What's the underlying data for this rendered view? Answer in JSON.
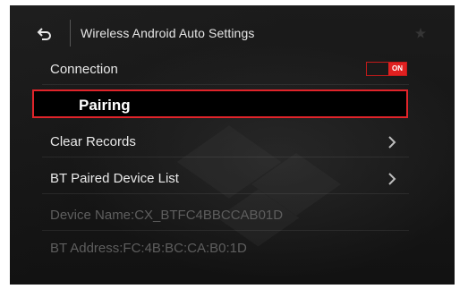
{
  "header": {
    "title": "Wireless Android Auto Settings",
    "back_icon": "back-arrow-icon",
    "corner_icon": "star-icon"
  },
  "settings": {
    "connection": {
      "label": "Connection",
      "toggle_state": "ON"
    },
    "pairing": {
      "label": "Pairing",
      "selected": true
    },
    "clear_records": {
      "label": "Clear Records"
    },
    "bt_paired_device_list": {
      "label": "BT Paired Device List"
    },
    "device_name": {
      "label": "Device Name:CX_BTFC4BBCCAB01D"
    },
    "bt_address": {
      "label": "BT Address:FC:4B:BC:CA:B0:1D"
    }
  },
  "colors": {
    "accent": "#e0242a",
    "toggle_on": "#e02020",
    "background": "#161616",
    "text_primary": "#e8e8e8",
    "text_disabled": "#5e5e5e"
  }
}
